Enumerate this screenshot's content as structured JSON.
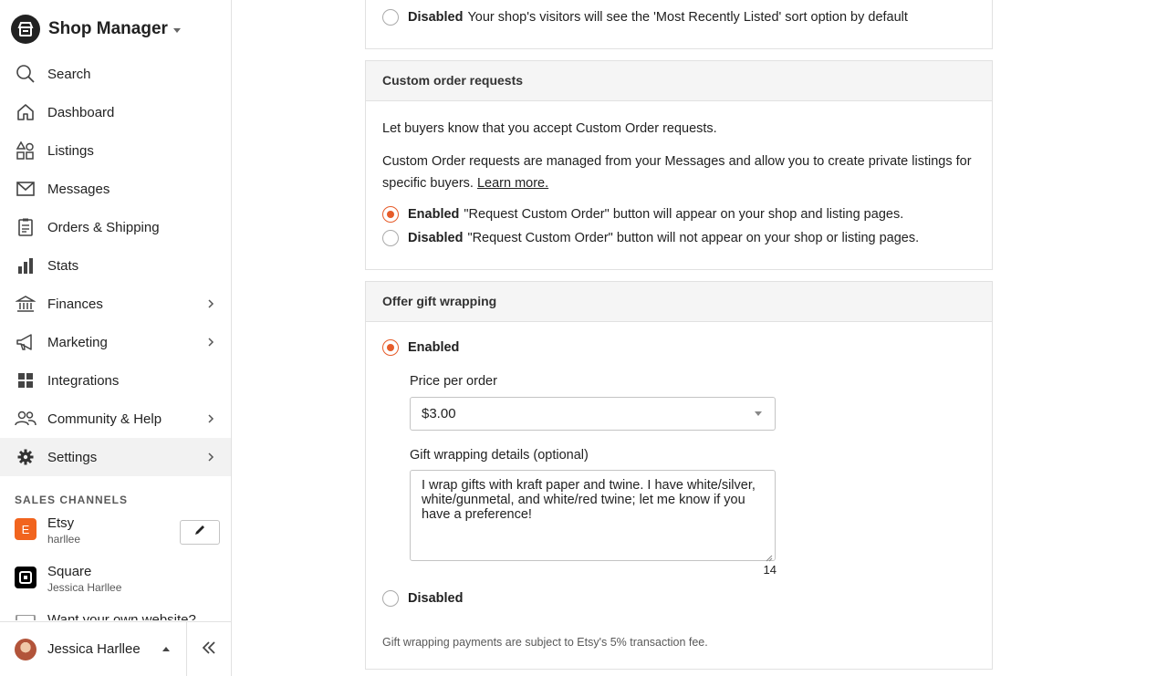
{
  "sidebar": {
    "brand_title": "Shop Manager",
    "nav": [
      {
        "label": "Search",
        "icon": "search-icon"
      },
      {
        "label": "Dashboard",
        "icon": "home-icon"
      },
      {
        "label": "Listings",
        "icon": "shapes-icon"
      },
      {
        "label": "Messages",
        "icon": "mail-icon"
      },
      {
        "label": "Orders & Shipping",
        "icon": "clipboard-icon"
      },
      {
        "label": "Stats",
        "icon": "bar-chart-icon"
      },
      {
        "label": "Finances",
        "icon": "bank-icon"
      },
      {
        "label": "Marketing",
        "icon": "megaphone-icon"
      },
      {
        "label": "Integrations",
        "icon": "grid-icon"
      },
      {
        "label": "Community & Help",
        "icon": "people-icon"
      },
      {
        "label": "Settings",
        "icon": "gear-icon"
      }
    ],
    "sales_channels_title": "SALES CHANNELS",
    "channels": [
      {
        "name": "Etsy",
        "sub": "harllee",
        "icon_letter": "E",
        "color": "#f1641e"
      },
      {
        "name": "Square",
        "sub": "Jessica Harllee",
        "color": "#000000"
      }
    ],
    "own_website_text": "Want your own website?",
    "user_name": "Jessica Harllee"
  },
  "top_panel": {
    "disabled_label": "Disabled",
    "disabled_desc": "Your shop's visitors will see the 'Most Recently Listed' sort option by default"
  },
  "custom_orders": {
    "title": "Custom order requests",
    "intro": "Let buyers know that you accept Custom Order requests.",
    "body": "Custom Order requests are managed from your Messages and allow you to create private listings for specific buyers.",
    "learn_more": "Learn more.",
    "enabled_label": "Enabled",
    "enabled_desc": "\"Request Custom Order\" button will appear on your shop and listing pages.",
    "disabled_label": "Disabled",
    "disabled_desc": "\"Request Custom Order\" button will not appear on your shop or listing pages."
  },
  "gift_wrapping": {
    "title": "Offer gift wrapping",
    "enabled_label": "Enabled",
    "price_label": "Price per order",
    "price_value": "$3.00",
    "details_label": "Gift wrapping details (optional)",
    "details_value": "I wrap gifts with kraft paper and twine. I have white/silver, white/gunmetal, and white/red twine; let me know if you have a preference!",
    "char_count": "14",
    "disabled_label": "Disabled",
    "fee_note": "Gift wrapping payments are subject to Etsy's 5% transaction fee."
  },
  "colors": {
    "accent": "#e65c2a",
    "etsy": "#f1641e"
  }
}
